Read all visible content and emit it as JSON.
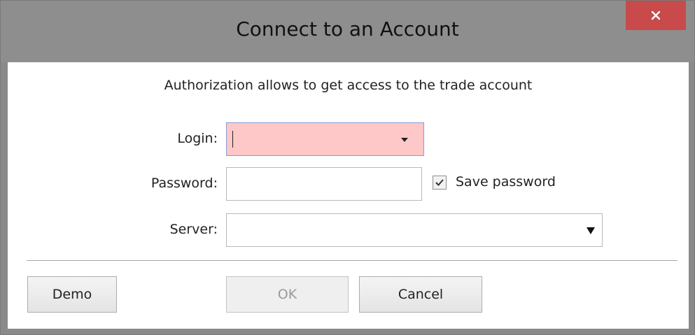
{
  "window": {
    "title": "Connect to an Account",
    "close_glyph": "×"
  },
  "dialog": {
    "subtitle": "Authorization allows to get access to the trade account"
  },
  "form": {
    "login": {
      "label": "Login:",
      "value": ""
    },
    "password": {
      "label": "Password:",
      "value": ""
    },
    "save_password": {
      "label": "Save password",
      "checked": true
    },
    "server": {
      "label": "Server:",
      "value": ""
    }
  },
  "buttons": {
    "demo": "Demo",
    "ok": "OK",
    "cancel": "Cancel"
  },
  "colors": {
    "titlebar": "#8e8e8e",
    "close_button": "#c84a4a",
    "login_field_bg": "#ffc8c8",
    "login_field_border": "#8a9ad8"
  },
  "icons": {
    "close": "close-icon",
    "login_dropdown": "chevron-down-icon",
    "server_dropdown": "chevron-down-icon",
    "checkbox": "checkmark-icon"
  }
}
